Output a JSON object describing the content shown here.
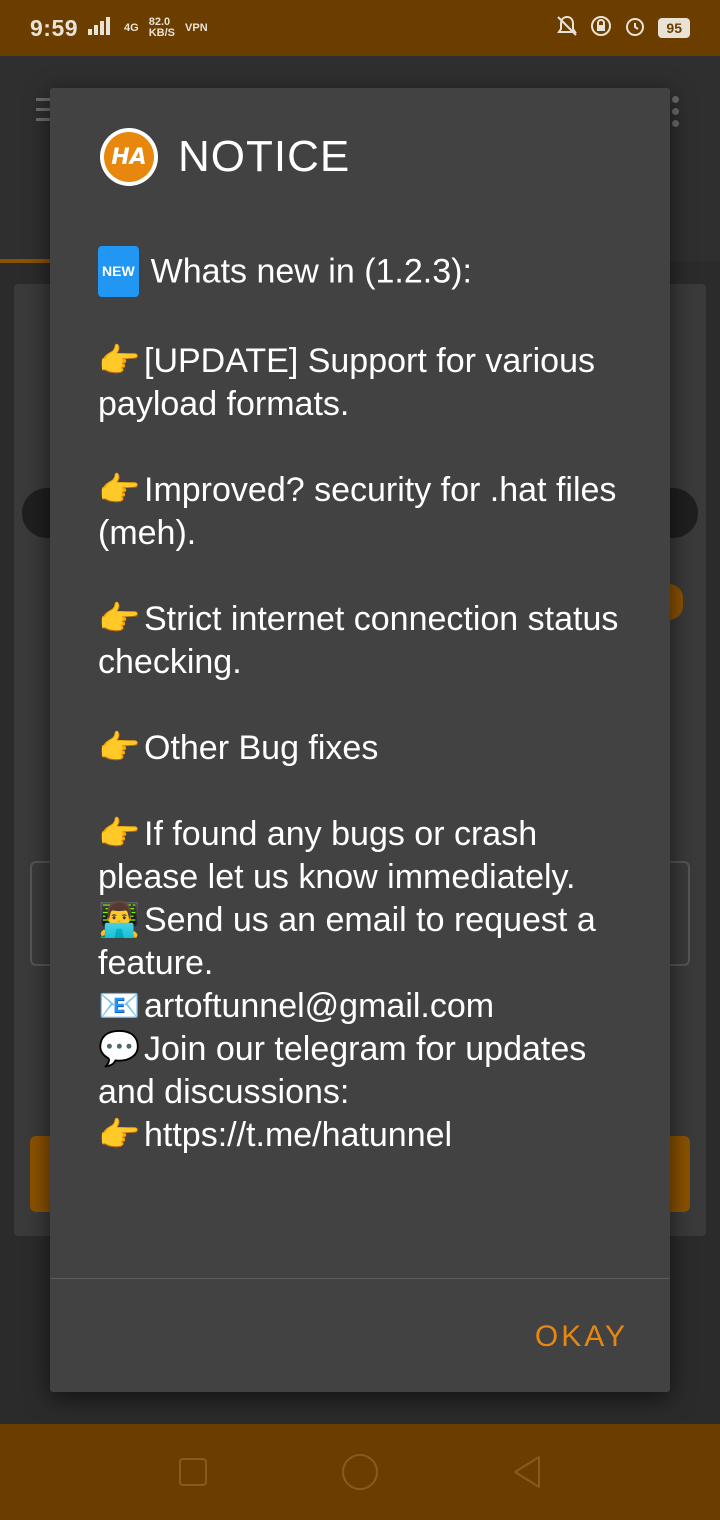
{
  "status_bar": {
    "time": "9:59",
    "speed_value": "82.0",
    "speed_unit": "KB/S",
    "vpn": "VPN",
    "network": "4G",
    "battery": "95"
  },
  "dialog": {
    "title": "NOTICE",
    "logo_text": "HA",
    "lines": {
      "whats_new": "Whats new in (1.2.3):",
      "update": "[UPDATE] Support for various payload formats.",
      "security": "Improved? security for .hat files (meh).",
      "internet": "Strict internet connection status checking.",
      "bugfixes": "Other Bug fixes",
      "report": "If found any bugs or crash please let us know immediately.",
      "feature": "Send us an email to request a feature.",
      "email": "artoftunnel@gmail.com",
      "telegram": "Join our telegram for updates and discussions:",
      "link": "https://t.me/hatunnel"
    },
    "new_badge": "NEW",
    "okay_label": "OKAY"
  },
  "colors": {
    "accent": "#e8870e",
    "dialog_bg": "#424242",
    "status_bar": "#6b3e00"
  }
}
